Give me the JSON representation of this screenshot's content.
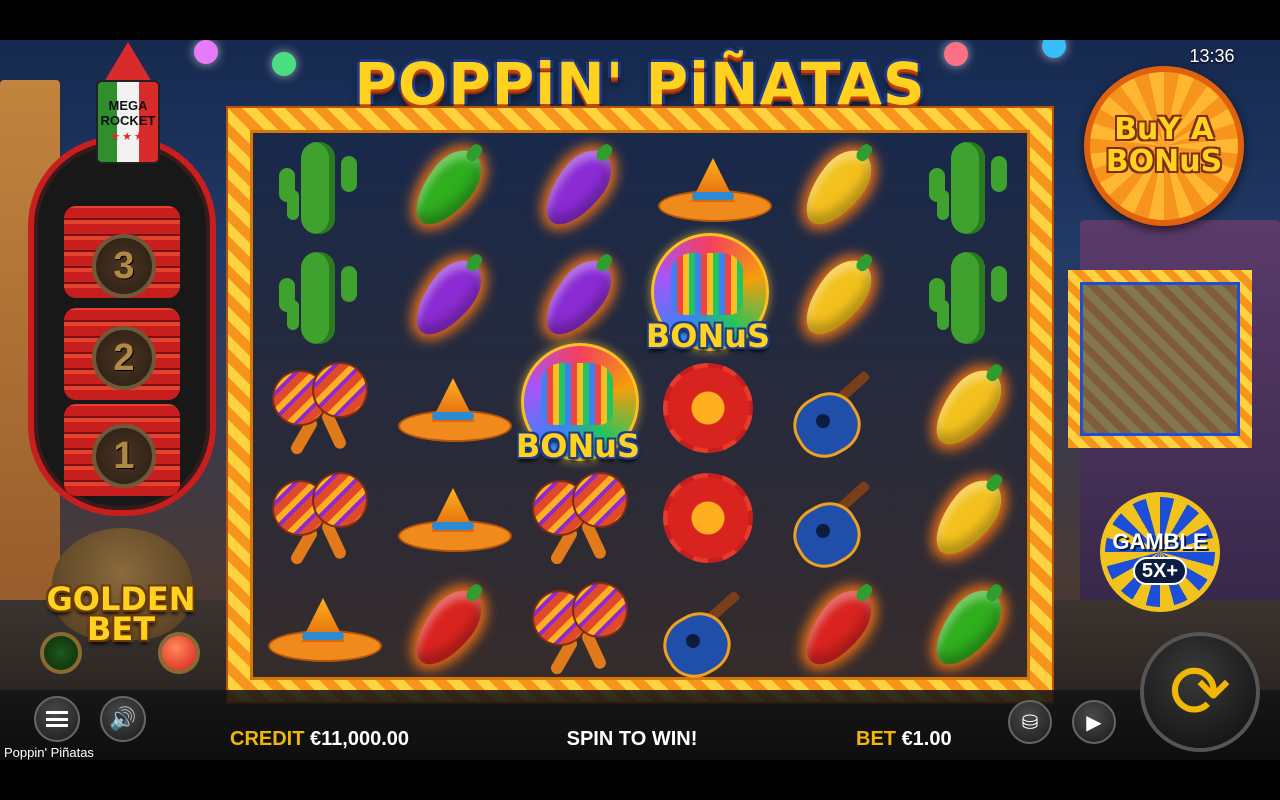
{
  "game": {
    "title": "POPPiN' PiÑATAS",
    "name_footer": "Poppin' Piñatas",
    "clock": "13:36"
  },
  "rocket": {
    "label_line1": "MEGA",
    "label_line2": "ROCKET",
    "stars": "★★★",
    "levels": [
      "3",
      "2",
      "1"
    ]
  },
  "golden_bet": {
    "label_line1": "GOLDEN",
    "label_line2": "BET",
    "state": "on"
  },
  "buy_bonus": {
    "label_line1": "BuY A",
    "label_line2": "BONuS"
  },
  "gamble": {
    "label": "GAMBLE",
    "multiplier": "5X+"
  },
  "bonus_symbol_label": "BONuS",
  "reels": [
    [
      "cactus",
      "cactus",
      "maracas",
      "maracas",
      "sombrero"
    ],
    [
      "pepper-green",
      "pepper-purple",
      "sombrero",
      "sombrero",
      "pepper-red"
    ],
    [
      "pepper-purple",
      "pepper-purple",
      "bonus",
      "maracas",
      "maracas"
    ],
    [
      "sombrero",
      "bonus",
      "flower",
      "flower",
      "guitar"
    ],
    [
      "pepper-yellow",
      "pepper-yellow",
      "guitar",
      "guitar",
      "pepper-red"
    ],
    [
      "cactus",
      "cactus",
      "pepper-yellow",
      "pepper-yellow",
      "pepper-green"
    ]
  ],
  "bottom": {
    "credit_label": "CREDIT",
    "credit_value": "€11,000.00",
    "message": "SPIN TO WIN!",
    "bet_label": "BET",
    "bet_value": "€1.00"
  },
  "icons": {
    "menu": "menu-icon",
    "sound": "speaker-icon",
    "coins": "coin-stack-icon",
    "autoplay": "autoplay-icon",
    "spin": "spin-arrows-icon"
  },
  "colors": {
    "accent_gold": "#f2b705",
    "frame_orange": "#f7941d",
    "rocket_red": "#c81e1e"
  }
}
